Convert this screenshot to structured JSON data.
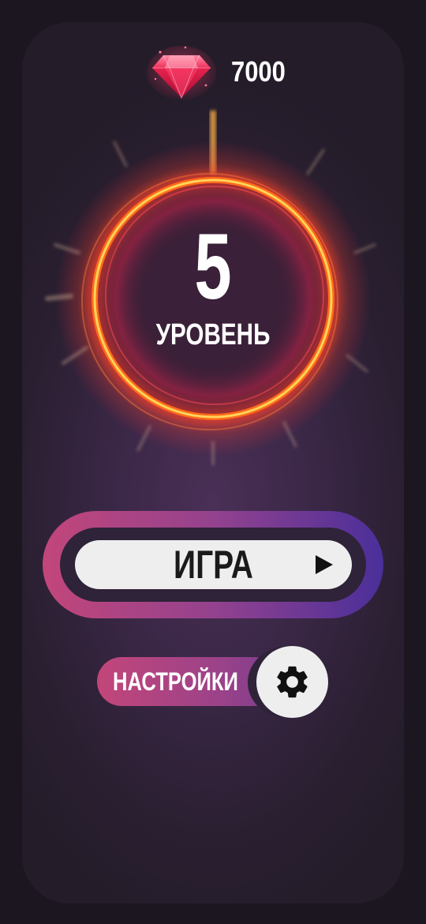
{
  "currency": {
    "icon": "ruby-gem-icon",
    "amount": "7000",
    "gem_color": "#e8234f"
  },
  "level": {
    "number": "5",
    "label": "УРОВЕНЬ",
    "ring_color": "#ff6a1a",
    "glow_color": "#ff3a2a"
  },
  "play": {
    "label": "ИГРА",
    "icon": "play-triangle-icon",
    "gradient": [
      "#c2467a",
      "#94428e",
      "#4a2f9a"
    ]
  },
  "settings": {
    "label": "НАСТРОЙКИ",
    "icon": "gear-icon"
  }
}
